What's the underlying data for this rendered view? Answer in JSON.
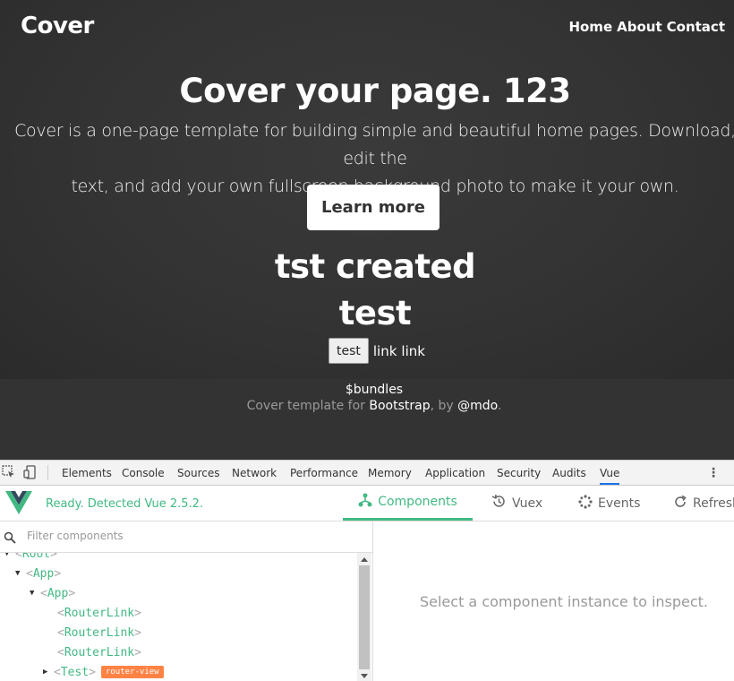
{
  "cover": {
    "brand": "Cover",
    "nav": [
      "Home",
      "About",
      "Contact"
    ],
    "title": "Cover your page. 123",
    "lead_line1": "Cover is a one-page template for building simple and beautiful home pages. Download, edit the",
    "lead_line2": "text, and add your own fullscreen background photo to make it your own.",
    "learn_more": "Learn more",
    "created": "tst created",
    "test_heading": "test",
    "test_button": "test",
    "links": [
      "link",
      "link"
    ]
  },
  "footer": {
    "bundles": "$bundles",
    "credit_prefix": "Cover template for ",
    "bootstrap": "Bootstrap",
    "credit_mid": ", by ",
    "author": "@mdo",
    "credit_suffix": "."
  },
  "devtools": {
    "tabs": [
      "Elements",
      "Console",
      "Sources",
      "Network",
      "Performance",
      "Memory",
      "Application",
      "Security",
      "Audits",
      "Vue"
    ],
    "active_tab": "Vue"
  },
  "vue": {
    "status": "Ready. Detected Vue 2.5.2.",
    "tabs": [
      "Components",
      "Vuex",
      "Events",
      "Refresh"
    ],
    "filter_placeholder": "Filter components",
    "tree": [
      {
        "name": "Root",
        "depth": 0
      },
      {
        "name": "App",
        "depth": 1
      },
      {
        "name": "App",
        "depth": 2
      },
      {
        "name": "RouterLink",
        "depth": 3
      },
      {
        "name": "RouterLink",
        "depth": 3
      },
      {
        "name": "RouterLink",
        "depth": 3
      },
      {
        "name": "Test",
        "depth": 3,
        "badge": "router-view"
      }
    ],
    "inspect_hint": "Select a component instance to inspect."
  },
  "colors": {
    "vue_green": "#42b983",
    "badge_orange": "#ff8344",
    "cover_bg": "#333333",
    "active_tab_blue": "#1a73e8"
  }
}
